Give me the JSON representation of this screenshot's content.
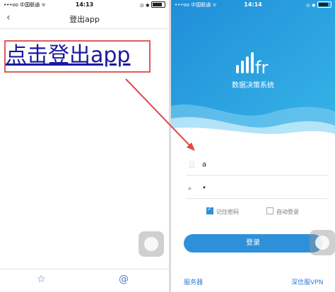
{
  "left_screen": {
    "status": {
      "carrier": "•••oo 中国联通 ᯤ",
      "time": "14:13",
      "right_icons": "⊙ ✱ "
    },
    "nav": {
      "back_icon": "chevron-left",
      "title": "登出app"
    },
    "logout_link": "点击登出app",
    "tabs": [
      {
        "icon": "star-icon",
        "glyph": "☆"
      },
      {
        "icon": "at-icon",
        "glyph": "@"
      }
    ]
  },
  "right_screen": {
    "status": {
      "carrier": "•••oo 中国联通 ᯤ",
      "time": "14:14",
      "right_icons": "⊙ ✱ "
    },
    "app_name": "数据决策系统",
    "username": {
      "icon": "user-icon",
      "value": "a"
    },
    "password": {
      "icon": "lock-icon",
      "value": "•"
    },
    "remember_password": {
      "label": "记住密码",
      "checked": true
    },
    "auto_login": {
      "label": "自动登录",
      "checked": false
    },
    "login_button": "登录",
    "footer": {
      "server": "服务器",
      "vpn": "深信服VPN"
    }
  },
  "colors": {
    "accent": "#2f90da",
    "annotation_red": "#e05a5a",
    "link": "#1a1a9e"
  }
}
